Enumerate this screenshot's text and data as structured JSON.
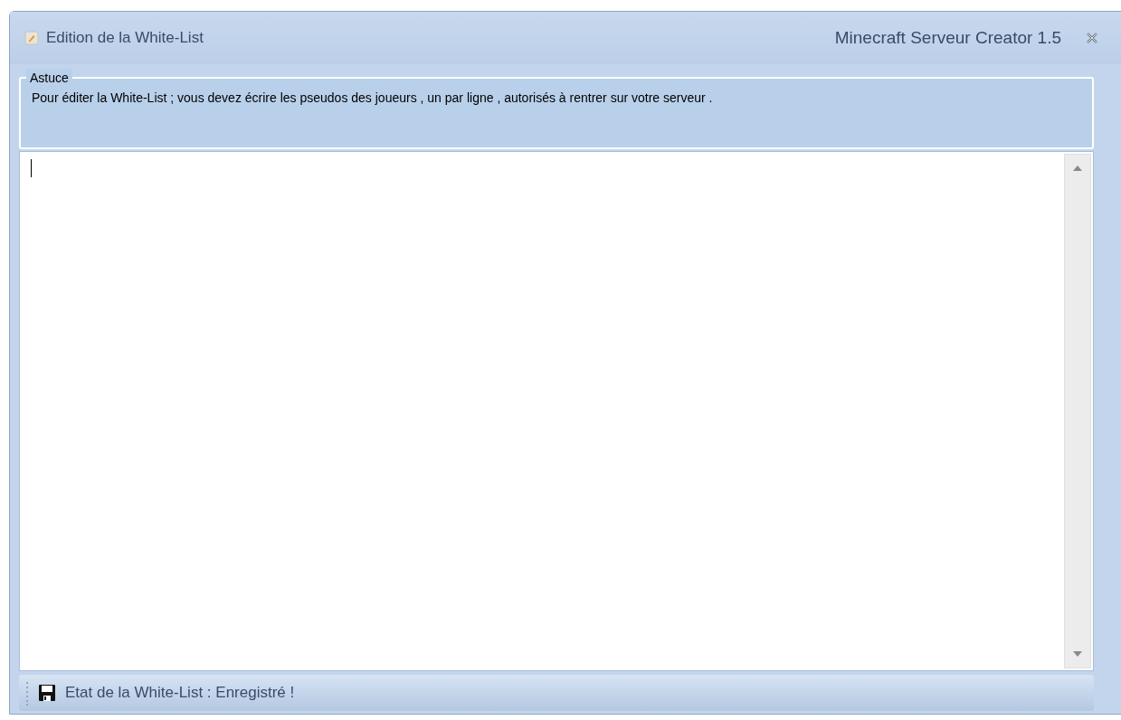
{
  "window": {
    "title": "Edition de la White-List",
    "app_name": "Minecraft Serveur Creator 1.5"
  },
  "tip": {
    "heading": "Astuce",
    "text": "Pour éditer la White-List ; vous devez écrire les pseudos des joueurs , un par ligne , autorisés à rentrer sur votre serveur ."
  },
  "status_bar": {
    "text": "Etat de la White-List : Enregistré !"
  }
}
